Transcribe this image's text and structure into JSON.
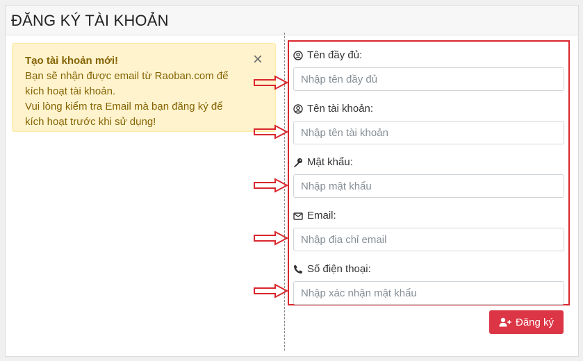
{
  "header": {
    "title": "ĐĂNG KÝ TÀI KHOẢN"
  },
  "alert": {
    "title": "Tạo tài khoản mới!",
    "lines": [
      "Bạn sẽ nhận được email từ Raoban.com để",
      "kích hoạt tài khoản.",
      "Vui lòng kiểm tra Email mà bạn đăng ký để",
      "kích hoạt trước khi sử dụng!"
    ],
    "close_label": "×"
  },
  "form": {
    "fields": [
      {
        "label": "Tên đầy đủ:",
        "placeholder": "Nhập tên đầy đủ",
        "icon": "user-circle-icon"
      },
      {
        "label": "Tên tài khoản:",
        "placeholder": "Nhập tên tài khoản",
        "icon": "user-circle-icon"
      },
      {
        "label": "Mật khẩu:",
        "placeholder": "Nhập mật khẩu",
        "icon": "key-icon"
      },
      {
        "label": "Email:",
        "placeholder": "Nhập địa chỉ email",
        "icon": "envelope-icon"
      },
      {
        "label": "Số điện thoại:",
        "placeholder": "Nhập xác nhận mật khẩu",
        "icon": "phone-icon"
      }
    ],
    "submit_label": "Đăng ký"
  },
  "colors": {
    "annotation_red": "#d9262d",
    "button_red": "#dc3545",
    "alert_bg": "#fff3cd",
    "alert_text": "#856404"
  }
}
